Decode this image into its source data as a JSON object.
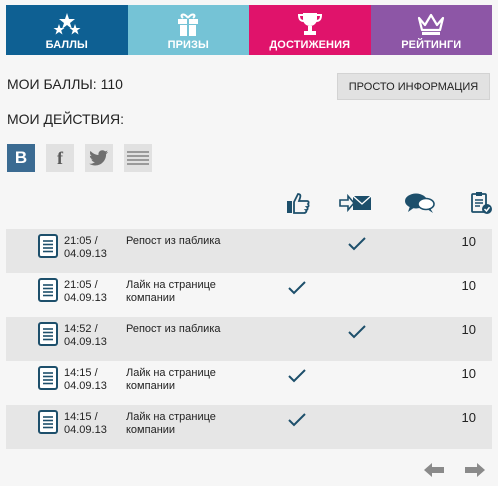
{
  "tabs": [
    {
      "label": "БАЛЛЫ",
      "icon": "stars-icon",
      "color": "#0e6093"
    },
    {
      "label": "ПРИЗЫ",
      "icon": "gift-icon",
      "color": "#75c3d6"
    },
    {
      "label": "ДОСТИЖЕНИЯ",
      "icon": "trophy-icon",
      "color": "#e0136b"
    },
    {
      "label": "РЕЙТИНГИ",
      "icon": "crown-icon",
      "color": "#8d56a6"
    }
  ],
  "points_label": "МОИ БАЛЛЫ: 110",
  "info_button": "ПРОСТО ИНФОРМАЦИЯ",
  "actions_title": "МОИ ДЕЙСТВИЯ:",
  "social": [
    {
      "label": "В",
      "icon": "vk-icon"
    },
    {
      "label": "f",
      "icon": "facebook-icon"
    },
    {
      "label": "",
      "icon": "twitter-icon"
    },
    {
      "label": "",
      "icon": "list-icon"
    }
  ],
  "columns": [
    "like-icon",
    "message-icon",
    "comment-icon",
    "clipboard-check-icon"
  ],
  "rows": [
    {
      "time": "21:05 /",
      "date": "04.09.13",
      "action": "Репост из паблика",
      "like": false,
      "repost": true,
      "points": "10"
    },
    {
      "time": "21:05 /",
      "date": "04.09.13",
      "action": "Лайк на странице компании",
      "like": true,
      "repost": false,
      "points": "10"
    },
    {
      "time": "14:52 /",
      "date": "04.09.13",
      "action": "Репост из паблика",
      "like": false,
      "repost": true,
      "points": "10"
    },
    {
      "time": "14:15 /",
      "date": "04.09.13",
      "action": "Лайк на странице компании",
      "like": true,
      "repost": false,
      "points": "10"
    },
    {
      "time": "14:15 /",
      "date": "04.09.13",
      "action": "Лайк на странице компании",
      "like": true,
      "repost": false,
      "points": "10"
    }
  ],
  "accent_color": "#1d4f6b"
}
